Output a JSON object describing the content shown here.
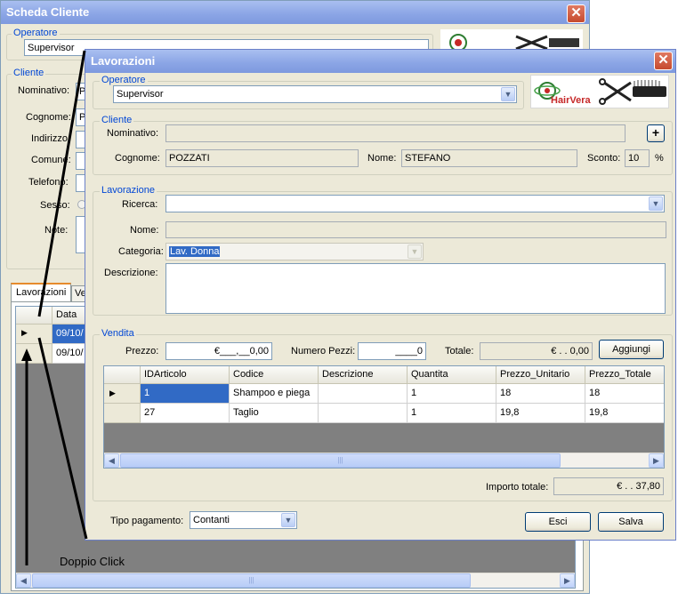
{
  "back_window": {
    "title": "Scheda Cliente",
    "operatore_legend": "Operatore",
    "operatore_value": "Supervisor",
    "cliente_legend": "Cliente",
    "labels": [
      "Nominativo:",
      "Cognome:",
      "Indirizzo:",
      "Comune:",
      "Telefono:",
      "Sesso:",
      "Note:"
    ],
    "field_fragments": [
      "P",
      "P"
    ],
    "tabs": [
      "Lavorazioni",
      "Ve"
    ],
    "grid_header": "Data",
    "grid_rows": [
      "09/10/",
      "09/10/"
    ]
  },
  "annotation": {
    "label": "Doppio Click"
  },
  "front_window": {
    "title": "Lavorazioni",
    "operatore": {
      "legend": "Operatore",
      "value": "Supervisor"
    },
    "logo_text": "HairVera",
    "cliente": {
      "legend": "Cliente",
      "nominativo_label": "Nominativo:",
      "nominativo_value": "",
      "add_label": "+",
      "cognome_label": "Cognome:",
      "cognome_value": "POZZATI",
      "nome_label": "Nome:",
      "nome_value": "STEFANO",
      "sconto_label": "Sconto:",
      "sconto_value": "10",
      "percent": "%"
    },
    "lavorazione": {
      "legend": "Lavorazione",
      "ricerca_label": "Ricerca:",
      "ricerca_value": "",
      "nome_label": "Nome:",
      "nome_value": "",
      "categoria_label": "Categoria:",
      "categoria_value": "Lav. Donna",
      "descrizione_label": "Descrizione:",
      "descrizione_value": ""
    },
    "vendita": {
      "legend": "Vendita",
      "prezzo_label": "Prezzo:",
      "prezzo_value": "€___,__0,00",
      "pezzi_label": "Numero Pezzi:",
      "pezzi_value": "____0",
      "totale_label": "Totale:",
      "totale_value": "€  .  . 0,00",
      "aggiungi_label": "Aggiungi",
      "columns": [
        "IDArticolo",
        "Codice",
        "Descrizione",
        "Quantita",
        "Prezzo_Unitario",
        "Prezzo_Totale"
      ],
      "rows": [
        [
          "1",
          "Shampoo e piega",
          "",
          "1",
          "18",
          "18"
        ],
        [
          "27",
          "Taglio",
          "",
          "1",
          "19,8",
          "19,8"
        ]
      ],
      "importo_label": "Importo totale:",
      "importo_value": "€  .  . 37,80"
    },
    "pagamento": {
      "label": "Tipo pagamento:",
      "value": "Contanti"
    },
    "esci_label": "Esci",
    "salva_label": "Salva"
  },
  "colors": {
    "accent": "#0046d5",
    "selection": "#316ac5",
    "titlebar": "#8ca6e6"
  }
}
